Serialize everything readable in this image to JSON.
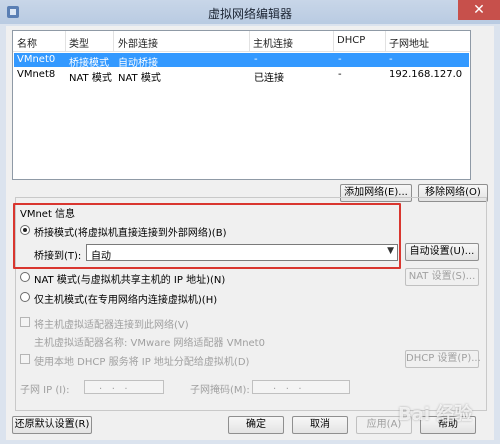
{
  "window": {
    "title": "虚拟网络编辑器",
    "close_glyph": "✕"
  },
  "table": {
    "headers": [
      "名称",
      "类型",
      "外部连接",
      "主机连接",
      "DHCP",
      "子网地址"
    ],
    "rows": [
      [
        "VMnet0",
        "桥接模式",
        "自动桥接",
        "-",
        "-",
        "-"
      ],
      [
        "VMnet8",
        "NAT 模式",
        "NAT 模式",
        "已连接",
        "-",
        "192.168.127.0"
      ]
    ],
    "selected_row": 0
  },
  "buttons": {
    "add_network": "添加网络(E)...",
    "remove_network": "移除网络(O)",
    "auto_settings": "自动设置(U)...",
    "nat_settings": "NAT 设置(S)...",
    "dhcp_settings": "DHCP 设置(P)...",
    "restore_defaults": "还原默认设置(R)",
    "ok": "确定",
    "cancel": "取消",
    "apply": "应用(A)",
    "help": "帮助"
  },
  "vmnet_info": {
    "legend": "VMnet 信息",
    "bridged_label": "桥接模式(将虚拟机直接连接到外部网络)(B)",
    "bridge_to_label": "桥接到(T):",
    "bridge_to_value": "自动",
    "nat_label": "NAT 模式(与虚拟机共享主机的 IP 地址)(N)",
    "hostonly_label": "仅主机模式(在专用网络内连接虚拟机)(H)",
    "connect_adapter_label": "将主机虚拟适配器连接到此网络(V)",
    "adapter_name_label": "主机虚拟适配器名称: VMware 网络适配器 VMnet0",
    "use_dhcp_label": "使用本地 DHCP 服务将 IP 地址分配给虚拟机(D)",
    "subnet_ip_label": "子网 IP (I):",
    "subnet_mask_label": "子网掩码(M):",
    "ip_placeholder": ".   .   .",
    "selected_mode": "bridged"
  },
  "watermark": "Bai 经验",
  "colors": {
    "selection": "#3399ff",
    "highlight_box": "#d9362f",
    "close_button": "#c7504b"
  }
}
